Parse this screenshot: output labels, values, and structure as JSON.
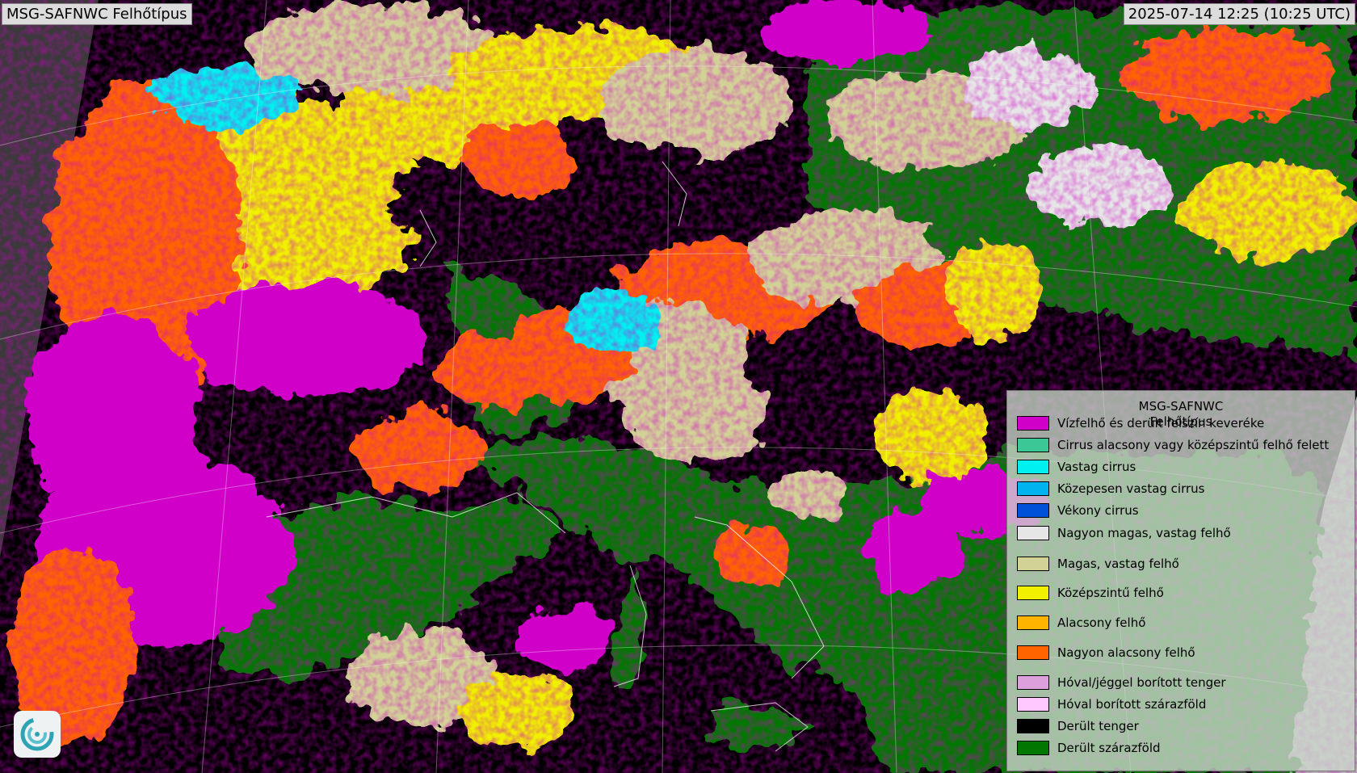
{
  "header": {
    "title": "MSG-SAFNWC Felhőtípus",
    "timestamp": "2025-07-14 12:25 (10:25 UTC)"
  },
  "legend": {
    "title_line1": "MSG-SAFNWC",
    "title_line2": "Felhőtípus",
    "items": [
      {
        "label": "Vízfelhő és derült felszín keveréke",
        "color": "#d000c8"
      },
      {
        "label": "Cirrus alacsony vagy középszintű felhő felett",
        "color": "#3cc896"
      },
      {
        "label": "Vastag cirrus",
        "color": "#00f0f0"
      },
      {
        "label": "Közepesen vastag cirrus",
        "color": "#00b4f0"
      },
      {
        "label": "Vékony cirrus",
        "color": "#0050d8"
      },
      {
        "label": "Nagyon magas, vastag felhő",
        "color": "#e6e6e6"
      },
      {
        "label": "Magas, vastag felhő",
        "color": "#d2d296"
      },
      {
        "label": "Középszintű felhő",
        "color": "#f0f000"
      },
      {
        "label": "Alacsony felhő",
        "color": "#ffb400"
      },
      {
        "label": "Nagyon alacsony felhő",
        "color": "#ff6400"
      },
      {
        "label": "Hóval/jéggel borított tenger",
        "color": "#dca0dc"
      },
      {
        "label": "Hóval borított szárazföld",
        "color": "#ffc8ff"
      },
      {
        "label": "Derült tenger",
        "color": "#000000"
      },
      {
        "label": "Derült szárazföld",
        "color": "#007800"
      }
    ]
  },
  "colors": {
    "offdisk": "#3a3a3a",
    "right_edge": "#b4b4b4",
    "coast": "#ffffff"
  },
  "icons": {
    "logo": "satellite-swirl-logo-icon"
  }
}
